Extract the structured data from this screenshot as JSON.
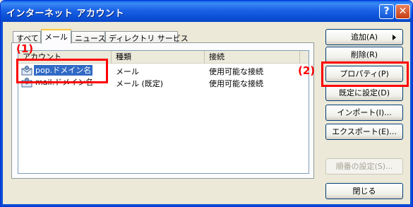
{
  "window": {
    "title": "インターネット アカウント",
    "help_glyph": "?",
    "close_glyph": "✕"
  },
  "tabs": [
    {
      "label": "すべて"
    },
    {
      "label": "メール"
    },
    {
      "label": "ニュース"
    },
    {
      "label": "ディレクトリ サービス"
    }
  ],
  "list": {
    "columns": [
      "アカウント",
      "種類",
      "接続"
    ],
    "rows": [
      {
        "name": "pop.ドメイン名",
        "type": "メール",
        "connection": "使用可能な接続",
        "selected": true
      },
      {
        "name": "mail.ドメイン名",
        "type": "メール (既定)",
        "connection": "使用可能な接続",
        "selected": false
      }
    ]
  },
  "buttons": {
    "add": "追加(A)",
    "remove": "削除(R)",
    "properties": "プロパティ(P)",
    "set_default": "既定に設定(D)",
    "import": "インポート(I)...",
    "export": "エクスポート(E)...",
    "order": "順番の設定(S)...",
    "close": "閉じる"
  },
  "annotations": {
    "label1": "(1)",
    "label2": "(2)"
  }
}
